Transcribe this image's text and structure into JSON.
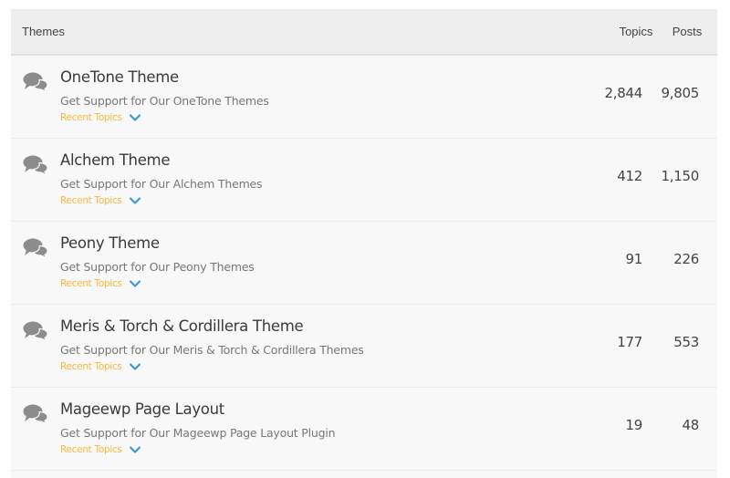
{
  "header": {
    "title": "Themes",
    "topics_label": "Topics",
    "posts_label": "Posts"
  },
  "forums": [
    {
      "name": "OneTone Theme",
      "description": "Get Support for Our OneTone Themes",
      "recent_label": "Recent Topics",
      "topics": "2,844",
      "posts": "9,805"
    },
    {
      "name": "Alchem Theme",
      "description": "Get Support for Our Alchem Themes",
      "recent_label": "Recent Topics",
      "topics": "412",
      "posts": "1,150"
    },
    {
      "name": "Peony Theme",
      "description": "Get Support for Our Peony Themes",
      "recent_label": "Recent Topics",
      "topics": "91",
      "posts": "226"
    },
    {
      "name": "Meris & Torch & Cordillera Theme",
      "description": "Get Support for Our Meris & Torch & Cordillera Themes",
      "recent_label": "Recent Topics",
      "topics": "177",
      "posts": "553"
    },
    {
      "name": "Mageewp Page Layout",
      "description": "Get Support for Our Mageewp Page Layout Plugin",
      "recent_label": "Recent Topics",
      "topics": "19",
      "posts": "48"
    }
  ],
  "icons": {
    "forum": "comments-icon",
    "expand": "chevron-down-icon"
  },
  "colors": {
    "accent_recent": "#f7b93c",
    "chevron": "#3a9ad9",
    "icon": "#8c8c8c"
  }
}
